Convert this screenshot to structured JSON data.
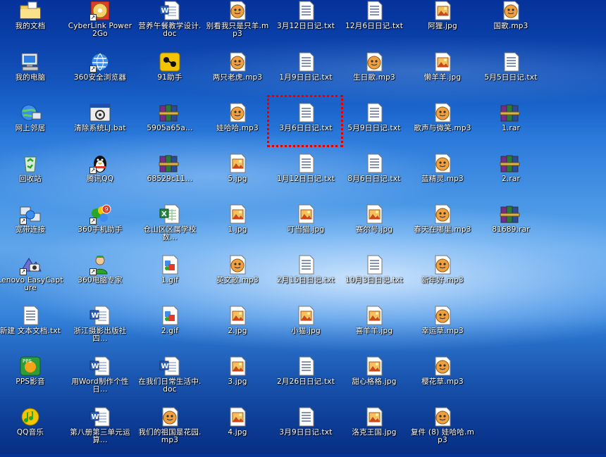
{
  "desktop": {
    "columns": [
      [
        {
          "label": "我的文档",
          "icon": "folder-icon",
          "shortcut": false
        },
        {
          "label": "我的电脑",
          "icon": "computer-icon",
          "shortcut": false
        },
        {
          "label": "网上邻居",
          "icon": "network-icon",
          "shortcut": false
        },
        {
          "label": "回收站",
          "icon": "recycle-bin-icon",
          "shortcut": false
        },
        {
          "label": "宽带连接",
          "icon": "broadband-icon",
          "shortcut": true
        },
        {
          "label": "Lenovo EasyCapture",
          "icon": "camera-icon",
          "shortcut": true
        },
        {
          "label": "新建 文本文档.txt",
          "icon": "text-file-icon",
          "shortcut": false
        },
        {
          "label": "PPS影音",
          "icon": "pps-icon",
          "shortcut": false
        },
        {
          "label": "QQ音乐",
          "icon": "qq-music-icon",
          "shortcut": false
        }
      ],
      [
        {
          "label": "CyberLink Power2Go",
          "icon": "disc-icon",
          "shortcut": true
        },
        {
          "label": "360安全浏览器",
          "icon": "browser-icon",
          "shortcut": true
        },
        {
          "label": "清除系统LJ.bat",
          "icon": "batch-file-icon",
          "shortcut": false
        },
        {
          "label": "腾讯QQ",
          "icon": "penguin-icon",
          "shortcut": true
        },
        {
          "label": "360手机助手",
          "icon": "phone-assistant-icon",
          "shortcut": true
        },
        {
          "label": "360电脑专家",
          "icon": "expert-icon",
          "shortcut": true
        },
        {
          "label": "浙江摄影出版社四...",
          "icon": "word-doc-icon",
          "shortcut": false
        },
        {
          "label": "用Word制作个性日...",
          "icon": "word-doc-icon",
          "shortcut": false
        },
        {
          "label": "第八册第三单元运算...",
          "icon": "word-doc-icon",
          "shortcut": false
        }
      ],
      [
        {
          "label": "营养午餐教学设计.doc",
          "icon": "word-doc-icon",
          "shortcut": false
        },
        {
          "label": "91助手",
          "icon": "assistant-icon",
          "shortcut": false
        },
        {
          "label": "5905a65a...",
          "icon": "rar-archive-icon",
          "shortcut": false
        },
        {
          "label": "68529c11...",
          "icon": "rar-archive-icon",
          "shortcut": false
        },
        {
          "label": "仓山区区属学校数...",
          "icon": "excel-icon",
          "shortcut": false
        },
        {
          "label": "1.gif",
          "icon": "gif-image-icon",
          "shortcut": false
        },
        {
          "label": "2.gif",
          "icon": "gif-image-icon",
          "shortcut": false
        },
        {
          "label": "在我们日常生活中.doc",
          "icon": "word-doc-icon",
          "shortcut": false
        },
        {
          "label": "我们的祖国是花园.mp3",
          "icon": "audio-file-icon",
          "shortcut": false
        }
      ],
      [
        {
          "label": "别看我只是只羊.mp3",
          "icon": "audio-file-icon",
          "shortcut": false
        },
        {
          "label": "两只老虎.mp3",
          "icon": "audio-file-icon",
          "shortcut": false
        },
        {
          "label": "娃哈哈.mp3",
          "icon": "audio-file-icon",
          "shortcut": false
        },
        {
          "label": "5.jpg",
          "icon": "image-file-icon",
          "shortcut": false
        },
        {
          "label": "1.jpg",
          "icon": "image-file-icon",
          "shortcut": false
        },
        {
          "label": "英文歌.mp3",
          "icon": "audio-file-icon",
          "shortcut": false
        },
        {
          "label": "2.jpg",
          "icon": "image-file-icon",
          "shortcut": false
        },
        {
          "label": "3.jpg",
          "icon": "image-file-icon",
          "shortcut": false
        },
        {
          "label": "4.jpg",
          "icon": "image-file-icon",
          "shortcut": false
        }
      ],
      [
        {
          "label": "3月12日日记.txt",
          "icon": "text-file-icon",
          "shortcut": false
        },
        {
          "label": "1月9日日记.txt",
          "icon": "text-file-icon",
          "shortcut": false
        },
        {
          "label": "3月6日日记.txt",
          "icon": "text-file-icon",
          "shortcut": false
        },
        {
          "label": "1月12日日记.txt",
          "icon": "text-file-icon",
          "shortcut": false
        },
        {
          "label": "叮当猫.jpg",
          "icon": "image-file-icon",
          "shortcut": false
        },
        {
          "label": "2月15日日记.txt",
          "icon": "text-file-icon",
          "shortcut": false
        },
        {
          "label": "小猫.jpg",
          "icon": "image-file-icon",
          "shortcut": false
        },
        {
          "label": "2月26日日记.txt",
          "icon": "text-file-icon",
          "shortcut": false
        },
        {
          "label": "3月9日日记.txt",
          "icon": "text-file-icon",
          "shortcut": false
        }
      ],
      [
        {
          "label": "12月6日日记.txt",
          "icon": "text-file-icon",
          "shortcut": false
        },
        {
          "label": "生日歌.mp3",
          "icon": "audio-file-icon",
          "shortcut": false
        },
        {
          "label": "5月9日日记.txt",
          "icon": "text-file-icon",
          "shortcut": false
        },
        {
          "label": "8月6日日记.txt",
          "icon": "text-file-icon",
          "shortcut": false
        },
        {
          "label": "赛尔号.jpg",
          "icon": "image-file-icon",
          "shortcut": false
        },
        {
          "label": "10月3日日记.txt",
          "icon": "text-file-icon",
          "shortcut": false
        },
        {
          "label": "喜羊羊.jpg",
          "icon": "image-file-icon",
          "shortcut": false
        },
        {
          "label": "甜心格格.jpg",
          "icon": "image-file-icon",
          "shortcut": false
        },
        {
          "label": "洛克王国.jpg",
          "icon": "image-file-icon",
          "shortcut": false
        }
      ],
      [
        {
          "label": "阿狸.jpg",
          "icon": "image-file-icon",
          "shortcut": false
        },
        {
          "label": "懒羊羊.jpg",
          "icon": "image-file-icon",
          "shortcut": false
        },
        {
          "label": "歌声与微笑.mp3",
          "icon": "audio-file-icon",
          "shortcut": false
        },
        {
          "label": "蓝精灵.mp3",
          "icon": "audio-file-icon",
          "shortcut": false
        },
        {
          "label": "春天在哪里.mp3",
          "icon": "audio-file-icon",
          "shortcut": false
        },
        {
          "label": "新年好.mp3",
          "icon": "audio-file-icon",
          "shortcut": false
        },
        {
          "label": "幸运草.mp3",
          "icon": "audio-file-icon",
          "shortcut": false
        },
        {
          "label": "樱花草.mp3",
          "icon": "audio-file-icon",
          "shortcut": false
        },
        {
          "label": "复件 (8) 娃哈哈.mp3",
          "icon": "audio-file-icon",
          "shortcut": false
        }
      ],
      [
        {
          "label": "国歌.mp3",
          "icon": "audio-file-icon",
          "shortcut": false
        },
        {
          "label": "5月5日日记.txt",
          "icon": "text-file-icon",
          "shortcut": false
        },
        {
          "label": "1.rar",
          "icon": "rar-archive-icon",
          "shortcut": false
        },
        {
          "label": "2.rar",
          "icon": "rar-archive-icon",
          "shortcut": false
        },
        {
          "label": "81689.rar",
          "icon": "rar-archive-icon",
          "shortcut": false
        }
      ]
    ],
    "selected_label": "3月6日日记.txt",
    "colors": {
      "label_text": "#ffffff",
      "selection_border": "#e00000",
      "desktop_blue": "#1f6fd6"
    }
  }
}
